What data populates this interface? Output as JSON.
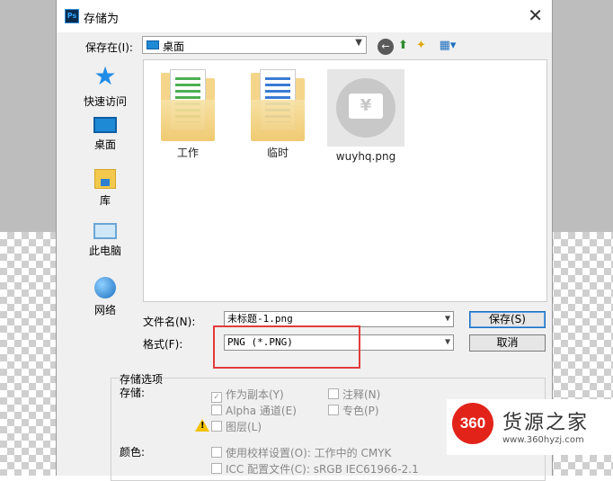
{
  "window": {
    "title": "存储为",
    "app_icon": "Ps"
  },
  "toolbar": {
    "save_in_label": "保存在(I):",
    "save_in_value": "桌面",
    "back_icon": "←",
    "up_icon": "⬆",
    "new_folder_icon": "✦",
    "view_icon": "▦▾"
  },
  "places": [
    {
      "name": "quick-access",
      "label": "快速访问"
    },
    {
      "name": "desktop",
      "label": "桌面"
    },
    {
      "name": "libraries",
      "label": "库"
    },
    {
      "name": "this-pc",
      "label": "此电脑"
    },
    {
      "name": "network",
      "label": "网络"
    }
  ],
  "files": [
    {
      "label": "工作",
      "type": "folder"
    },
    {
      "label": "临时",
      "type": "folder"
    },
    {
      "label": "wuyhq.png",
      "type": "image"
    }
  ],
  "form": {
    "filename_label": "文件名(N):",
    "filename_value": "未标题-1.png",
    "format_label": "格式(F):",
    "format_value": "PNG (*.PNG)",
    "save_button": "保存(S)",
    "cancel_button": "取消"
  },
  "options": {
    "title": "存储选项",
    "save_label": "存储:",
    "as_copy": "作为副本(Y)",
    "annotations": "注释(N)",
    "alpha": "Alpha 通道(E)",
    "spot": "专色(P)",
    "layers": "图层(L)",
    "color_label": "颜色:",
    "proof": "使用校样设置(O): 工作中的 CMYK",
    "icc": "ICC 配置文件(C): sRGB IEC61966-2.1"
  },
  "watermark": {
    "badge": "360",
    "name": "货源之家",
    "url": "www.360hyzj.com"
  }
}
